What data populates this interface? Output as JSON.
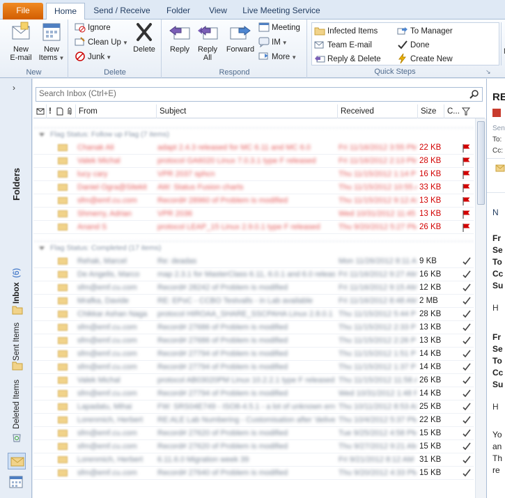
{
  "tabs": [
    "File",
    "Home",
    "Send / Receive",
    "Folder",
    "View",
    "Live Meeting Service"
  ],
  "ribbon": {
    "new_group": {
      "label": "New",
      "new_email": "New\nE-mail",
      "new_items": "New\nItems"
    },
    "delete_group": {
      "label": "Delete",
      "ignore": "Ignore",
      "clean_up": "Clean Up",
      "junk": "Junk",
      "delete": "Delete"
    },
    "respond_group": {
      "label": "Respond",
      "reply": "Reply",
      "reply_all": "Reply\nAll",
      "forward": "Forward",
      "meeting": "Meeting",
      "im": "IM",
      "more": "More"
    },
    "quicksteps_group": {
      "label": "Quick Steps",
      "items": [
        "Infected Items",
        "To Manager",
        "Team E-mail",
        "Done",
        "Reply & Delete",
        "Create New"
      ]
    },
    "cutoff_label": "N"
  },
  "nav": {
    "folders_label": "Folders",
    "inbox_label": "Inbox",
    "inbox_count": "(6)",
    "sent_label": "Sent Items",
    "deleted_label": "Deleted Items"
  },
  "search": {
    "placeholder": "Search Inbox (Ctrl+E)"
  },
  "columns": {
    "from": "From",
    "subject": "Subject",
    "received": "Received",
    "size": "Size",
    "categories": "C..."
  },
  "groups": [
    {
      "title": "Flag Status: Follow up Flag (7 items)",
      "status": "flagged",
      "rows": [
        {
          "from": "Chanak Ali",
          "subject": "adapt 2.4.3 released for MC 6.11 and MC 6.0",
          "received": "Fri 11/16/2012 3:55 PM",
          "size": "22 KB"
        },
        {
          "from": "Valek Michal",
          "subject": "protocol GA6020 Linux 7.0.3.1 type F released",
          "received": "Fri 11/16/2012 2:13 PM",
          "size": "28 KB"
        },
        {
          "from": "lucy cary",
          "subject": "VPR 2037 sphcn",
          "received": "Thu 11/15/2012 1:14 PM",
          "size": "16 KB"
        },
        {
          "from": "Daniel Ogra@Sitekit",
          "subject": "AW: Status Fusion charts",
          "received": "Thu 11/15/2012 10:55 AM",
          "size": "33 KB"
        },
        {
          "from": "sfm@emf.cu.com",
          "subject": "Record# 28960 of Problem is modified",
          "received": "Thu 11/15/2012 9:12 AM",
          "size": "13 KB"
        },
        {
          "from": "Shmerry, Adrian",
          "subject": "VPR 2036",
          "received": "Wed 10/31/2012 11:45 AM",
          "size": "13 KB"
        },
        {
          "from": "Anand S",
          "subject": "protocol LEAP_15 Linux 2.9.0.1 type F released",
          "received": "Thu 9/20/2012 5:27 PM",
          "size": "26 KB"
        }
      ]
    },
    {
      "title": "Flag Status: Completed (17 items)",
      "status": "completed",
      "rows": [
        {
          "from": "Rehak, Marcel",
          "subject": "Re: deadas",
          "received": "Mon 11/26/2012 8:11 AM",
          "size": "9 KB"
        },
        {
          "from": "De Angelis, Marco",
          "subject": "map 2.3.1 for MasterClass 6.11, 6.0.1 and 6.0 released",
          "received": "Fri 11/16/2012 9:27 AM",
          "size": "16 KB"
        },
        {
          "from": "sfm@emf.cu.com",
          "subject": "Record# 28242 of Problem is modified",
          "received": "Fri 11/16/2012 9:15 AM",
          "size": "12 KB"
        },
        {
          "from": "Mrafka, Davide",
          "subject": "RE: EPoC - CCBO Testvalls - in Lab available",
          "received": "Fri 11/16/2012 8:48 AM",
          "size": "2 MB"
        },
        {
          "from": "Chikkar Ashan Naga",
          "subject": "protocol HIROAA_SHARE_SSCPAHA Linux 2.8.0.1 released",
          "received": "Thu 11/15/2012 5:44 PM",
          "size": "28 KB"
        },
        {
          "from": "sfm@emf.cu.com",
          "subject": "Record# 27686 of Problem is modified",
          "received": "Thu 11/15/2012 2:33 PM",
          "size": "13 KB"
        },
        {
          "from": "sfm@emf.cu.com",
          "subject": "Record# 27686 of Problem is modified",
          "received": "Thu 11/15/2012 2:26 PM",
          "size": "13 KB"
        },
        {
          "from": "sfm@emf.cu.com",
          "subject": "Record# 27794 of Problem is modified",
          "received": "Thu 11/15/2012 1:51 PM",
          "size": "14 KB"
        },
        {
          "from": "sfm@emf.cu.com",
          "subject": "Record# 27794 of Problem is modified",
          "received": "Thu 11/15/2012 1:37 PM",
          "size": "14 KB"
        },
        {
          "from": "Valek Michal",
          "subject": "protocol AB03020PM Linux 10.2.2.1 type F released",
          "received": "Thu 11/15/2012 11:58 AM",
          "size": "26 KB"
        },
        {
          "from": "sfm@emf.cu.com",
          "subject": "Record# 27794 of Problem is modified",
          "received": "Wed 10/31/2012 1:48 PM",
          "size": "14 KB"
        },
        {
          "from": "Lapadatu, Mihai",
          "subject": "FW: SRS04E749 - ISO8-4.5.1 - a lot of unknown errors",
          "received": "Thu 10/11/2012 8:53 AM",
          "size": "25 KB"
        },
        {
          "from": "Lorenmich, Herbert",
          "subject": "RE:ALE Lab Numbering - Customisation after 'delivery'",
          "received": "Thu 10/4/2012 5:37 PM",
          "size": "22 KB"
        },
        {
          "from": "sfm@emf.cu.com",
          "subject": "Record# 27620 of Problem is modified",
          "received": "Tue 9/25/2012 4:58 PM",
          "size": "15 KB"
        },
        {
          "from": "sfm@emf.cu.com",
          "subject": "Record# 27620 of Problem is modified",
          "received": "Thu 9/27/2012 9:21 AM",
          "size": "15 KB"
        },
        {
          "from": "Lorenmich, Herbert",
          "subject": "6.11.6.0 Migration week 39",
          "received": "Fri 9/21/2012 8:12 AM",
          "size": "31 KB"
        },
        {
          "from": "sfm@emf.cu.com",
          "subject": "Record# 27640 of Problem is modified",
          "received": "Thu 9/20/2012 4:33 PM",
          "size": "15 KB"
        }
      ]
    }
  ],
  "reading_pane": {
    "subject_start": "RE",
    "header_labels": [
      "Sent",
      "To:",
      "Cc:"
    ],
    "lines": [
      "N",
      "Fr",
      "Se",
      "To",
      "Cc",
      "Su",
      "H",
      "Fr",
      "Se",
      "To",
      "Cc",
      "Su",
      "H",
      "Yo",
      "an",
      "Th",
      "re"
    ]
  },
  "colors": {
    "flag_red": "#d20000",
    "accent_blue": "#1f3a5f",
    "file_tab": "#e06800"
  }
}
